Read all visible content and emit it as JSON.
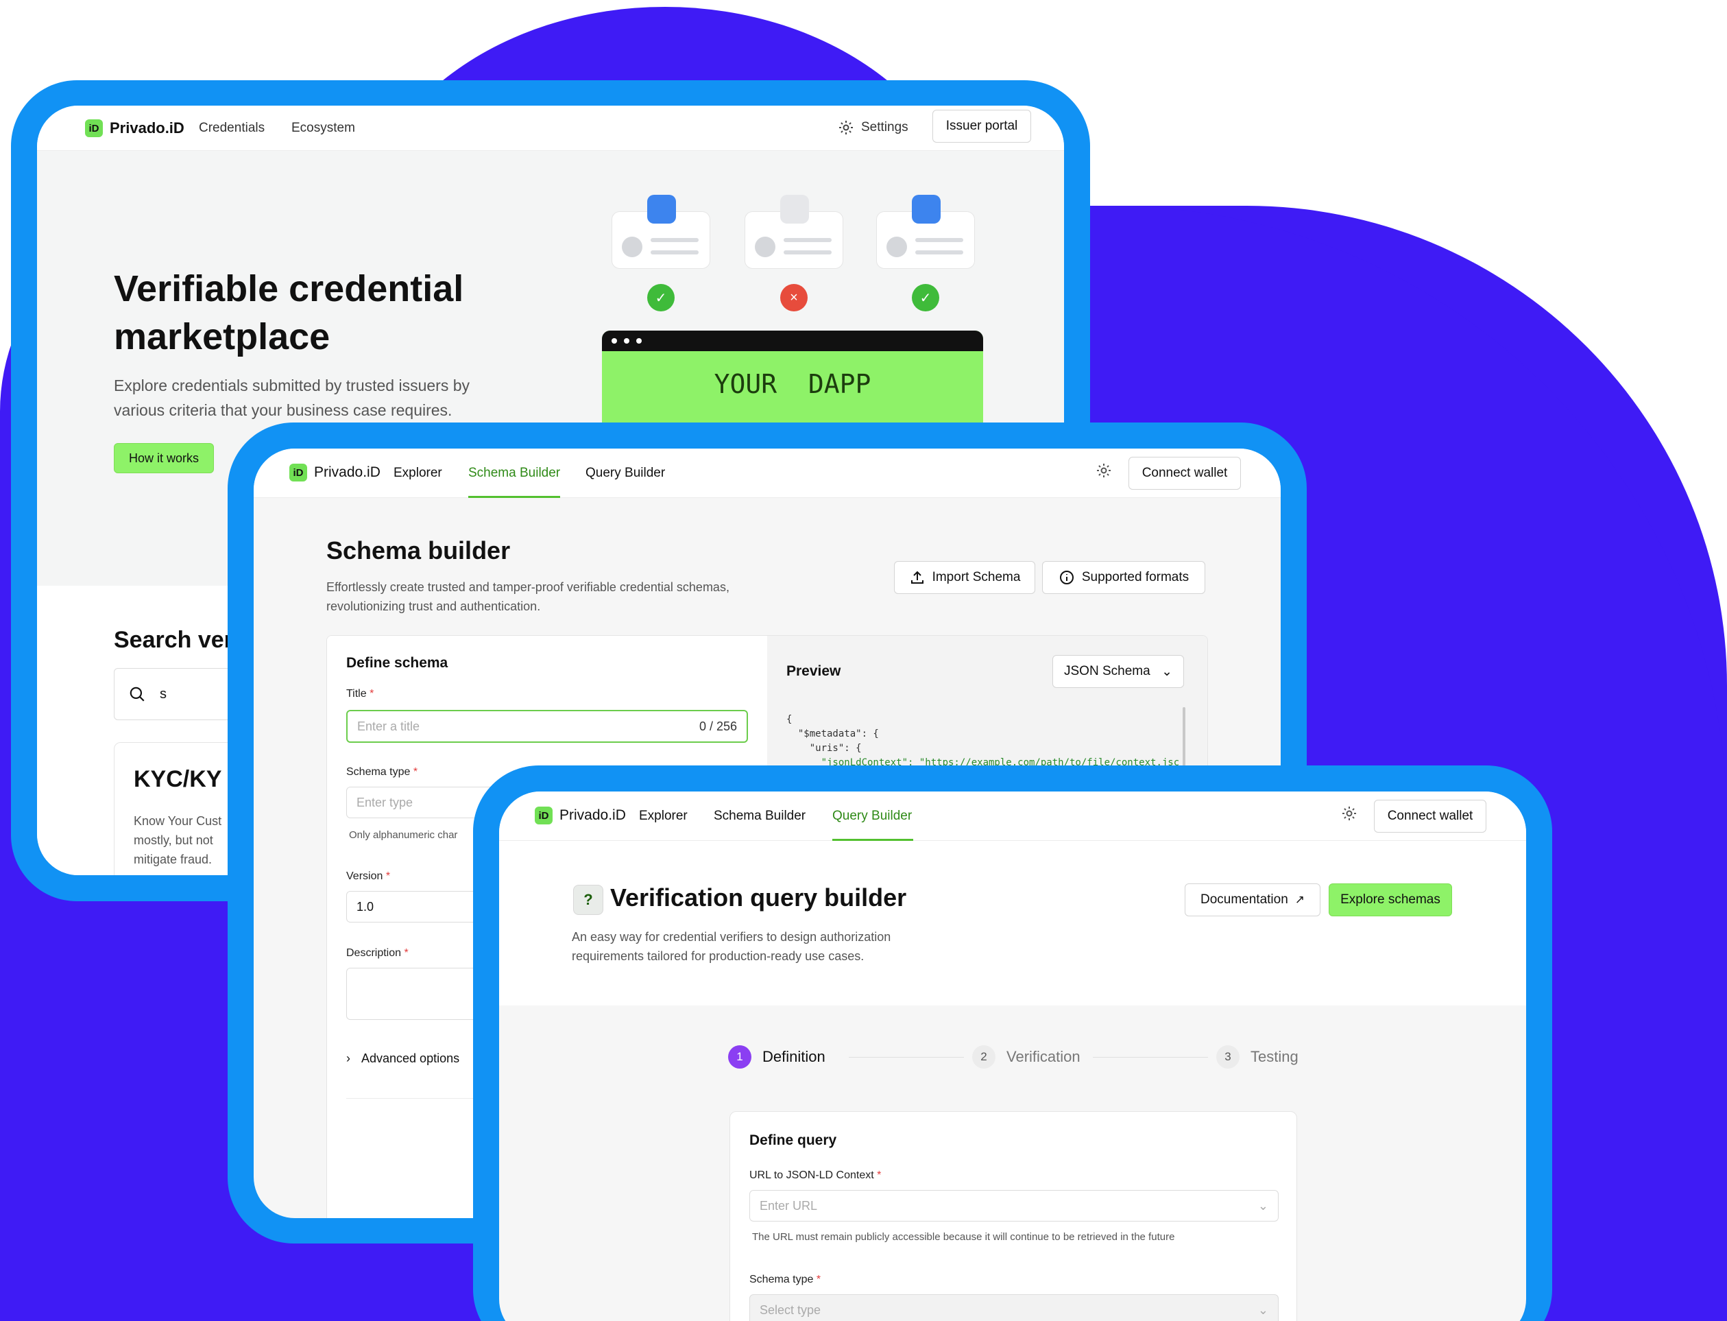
{
  "colors": {
    "accent_green": "#8ef268",
    "frame_blue": "#1192f4",
    "background_purple": "#3f1bf5",
    "step_purple": "#8b3ff2"
  },
  "brand": {
    "name": "Privado.iD",
    "mark": "iD"
  },
  "marketplace": {
    "nav": {
      "credentials": "Credentials",
      "ecosystem": "Ecosystem",
      "settings": "Settings",
      "issuer_portal": "Issuer portal"
    },
    "hero": {
      "title_line1": "Verifiable credential",
      "title_line2": "marketplace",
      "subtitle_line1": "Explore credentials submitted by trusted issuers by",
      "subtitle_line2": "various criteria that your business case requires.",
      "how_it_works": "How it works"
    },
    "dapp": {
      "label": "YOUR  DAPP"
    },
    "search": {
      "heading": "Search ver",
      "value": "s"
    },
    "kyc_card": {
      "title": "KYC/KY",
      "line1": "Know Your Cust",
      "line2": "mostly, but not",
      "line3": "mitigate fraud."
    }
  },
  "schema_builder": {
    "nav": {
      "explorer": "Explorer",
      "schema_builder": "Schema Builder",
      "query_builder": "Query Builder",
      "connect_wallet": "Connect wallet"
    },
    "title": "Schema builder",
    "desc_line1": "Effortlessly create trusted and tamper-proof verifiable credential schemas,",
    "desc_line2": "revolutionizing trust and authentication.",
    "import_schema": "Import Schema",
    "supported_formats": "Supported formats",
    "define_schema": "Define schema",
    "title_label": "Title",
    "title_placeholder": "Enter a title",
    "title_counter": "0 / 256",
    "schema_type_label": "Schema type",
    "schema_type_placeholder": "Enter type",
    "schema_type_hint": "Only alphanumeric char",
    "version_label": "Version",
    "version_value": "1.0",
    "description_label": "Description",
    "advanced_options": "Advanced options",
    "preview_label": "Preview",
    "format_select": "JSON Schema",
    "code_line1": "{",
    "code_line2": "  \"$metadata\": {",
    "code_line3": "    \"uris\": {",
    "code_line4": "      \"jsonLdContext\": \"https://example.com/path/to/file/context.jsc"
  },
  "query_builder": {
    "nav": {
      "explorer": "Explorer",
      "schema_builder": "Schema Builder",
      "query_builder": "Query Builder",
      "connect_wallet": "Connect wallet"
    },
    "icon_glyph": "?",
    "title": "Verification query builder",
    "desc_line1": "An easy way for credential verifiers to design authorization",
    "desc_line2": "requirements tailored for production-ready use cases.",
    "documentation": "Documentation",
    "explore_schemas": "Explore schemas",
    "steps": [
      {
        "num": "1",
        "label": "Definition"
      },
      {
        "num": "2",
        "label": "Verification"
      },
      {
        "num": "3",
        "label": "Testing"
      }
    ],
    "define_query": "Define query",
    "url_label": "URL to JSON-LD Context",
    "url_placeholder": "Enter URL",
    "url_hint": "The URL must remain publicly accessible because it will continue to be retrieved in the future",
    "schema_type_label": "Schema type",
    "schema_type_placeholder": "Select type"
  }
}
